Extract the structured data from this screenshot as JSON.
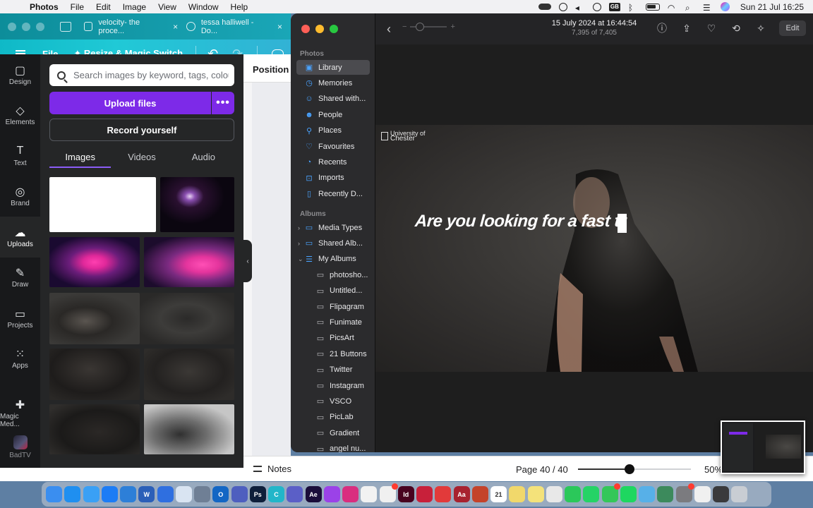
{
  "menubar": {
    "app": "Photos",
    "items": [
      "File",
      "Edit",
      "Image",
      "View",
      "Window",
      "Help"
    ],
    "gb_indicator": "GB",
    "clock": "Sun 21 Jul  16:25"
  },
  "browser": {
    "tabs": [
      {
        "title": "velocity- the proce...",
        "close": "×"
      },
      {
        "title": "tessa halliwell - Do...",
        "close": "×"
      }
    ]
  },
  "canva": {
    "toolbar": {
      "file_label": "File",
      "resize_label": "Resize & Magic Switch"
    },
    "rail": [
      {
        "label": "Design",
        "icon": "design-icon",
        "glyph": "▢"
      },
      {
        "label": "Elements",
        "icon": "elements-icon",
        "glyph": "◇"
      },
      {
        "label": "Text",
        "icon": "text-icon",
        "glyph": "T"
      },
      {
        "label": "Brand",
        "icon": "brand-icon",
        "glyph": "◎"
      },
      {
        "label": "Uploads",
        "icon": "uploads-icon",
        "glyph": "☁"
      },
      {
        "label": "Draw",
        "icon": "draw-icon",
        "glyph": "✎"
      },
      {
        "label": "Projects",
        "icon": "projects-icon",
        "glyph": "▭"
      },
      {
        "label": "Apps",
        "icon": "apps-icon",
        "glyph": "⁙"
      }
    ],
    "magic_label": "Magic Med...",
    "badtv_label": "BadTV",
    "search_placeholder": "Search images by keyword, tags, colour...",
    "upload_label": "Upload files",
    "more_label": "•••",
    "record_label": "Record yourself",
    "media_tabs": [
      "Images",
      "Videos",
      "Audio"
    ],
    "active_media_tab": "Images",
    "position_label": "Position",
    "notes_label": "Notes",
    "page_label": "Page 40 / 40",
    "zoom_percent": 50,
    "zoom_label": "50%",
    "accent": "#7d2ae8"
  },
  "photos": {
    "sidebar": {
      "photos_header": "Photos",
      "library": [
        {
          "label": "Library",
          "icon": "library-icon",
          "glyph": "▣"
        },
        {
          "label": "Memories",
          "icon": "memories-icon",
          "glyph": "◷"
        },
        {
          "label": "Shared with...",
          "icon": "shared-with-icon",
          "glyph": "☺"
        },
        {
          "label": "People",
          "icon": "people-icon",
          "glyph": "☻"
        },
        {
          "label": "Places",
          "icon": "places-icon",
          "glyph": "⚲"
        },
        {
          "label": "Favourites",
          "icon": "favourites-icon",
          "glyph": "♡"
        },
        {
          "label": "Recents",
          "icon": "recents-icon",
          "glyph": "◔"
        },
        {
          "label": "Imports",
          "icon": "imports-icon",
          "glyph": "⊡"
        },
        {
          "label": "Recently D...",
          "icon": "trash-icon",
          "glyph": "▯"
        }
      ],
      "albums_header": "Albums",
      "albums": [
        {
          "label": "Media Types",
          "chev": "›"
        },
        {
          "label": "Shared Alb...",
          "chev": "›"
        },
        {
          "label": "My Albums",
          "chev": "⌄"
        },
        {
          "label": "photosho...",
          "chev": ""
        },
        {
          "label": "Untitled...",
          "chev": ""
        },
        {
          "label": "Flipagram",
          "chev": ""
        },
        {
          "label": "Funimate",
          "chev": ""
        },
        {
          "label": "PicsArt",
          "chev": ""
        },
        {
          "label": "21 Buttons",
          "chev": ""
        },
        {
          "label": "Twitter",
          "chev": ""
        },
        {
          "label": "Instagram",
          "chev": ""
        },
        {
          "label": "VSCO",
          "chev": ""
        },
        {
          "label": "PicLab",
          "chev": ""
        },
        {
          "label": "Gradient",
          "chev": ""
        },
        {
          "label": "angel nu...",
          "chev": ""
        }
      ]
    },
    "toolbar": {
      "date": "15 July 2024 at 16:44:54",
      "count": "7,395 of 7,405",
      "edit_label": "Edit",
      "zoom_minus": "−",
      "zoom_plus": "+"
    },
    "photo": {
      "logo_line1": "University of",
      "logo_line2": "Chester",
      "overlay_text": "Are you looking for a fast tr"
    }
  },
  "dock": {
    "apps": [
      {
        "name": "finder",
        "color": "#3a8ef0",
        "text": ""
      },
      {
        "name": "safari",
        "color": "#1f8ff0",
        "text": ""
      },
      {
        "name": "mail",
        "color": "#3aa0f5",
        "text": ""
      },
      {
        "name": "app-store",
        "color": "#1c7cf5",
        "text": ""
      },
      {
        "name": "calendar-alt",
        "color": "#2d7fd8",
        "text": ""
      },
      {
        "name": "word",
        "color": "#2b5fb8",
        "text": "W"
      },
      {
        "name": "testflight",
        "color": "#2f6fe0",
        "text": ""
      },
      {
        "name": "preview",
        "color": "#d9e4f2",
        "text": ""
      },
      {
        "name": "photo-booth",
        "color": "#6f7f95",
        "text": ""
      },
      {
        "name": "outlook",
        "color": "#1366c4",
        "text": "O"
      },
      {
        "name": "teams",
        "color": "#4e5fbf",
        "text": ""
      },
      {
        "name": "photoshop",
        "color": "#0f1f3a",
        "text": "Ps"
      },
      {
        "name": "canva",
        "color": "#22b6c9",
        "text": "C"
      },
      {
        "name": "teams-2",
        "color": "#5b5fc7",
        "text": ""
      },
      {
        "name": "after-effects",
        "color": "#1a0d3a",
        "text": "Ae"
      },
      {
        "name": "podcasts",
        "color": "#9b42e8",
        "text": ""
      },
      {
        "name": "instagram",
        "color": "#d92e7f",
        "text": ""
      },
      {
        "name": "photos",
        "color": "#f2f2f2",
        "text": ""
      },
      {
        "name": "spark",
        "color": "#f0f0f0",
        "text": "",
        "badge": true
      },
      {
        "name": "indesign",
        "color": "#49021f",
        "text": "Id"
      },
      {
        "name": "ppt-red",
        "color": "#c8203a",
        "text": ""
      },
      {
        "name": "airmail",
        "color": "#e23a3a",
        "text": ""
      },
      {
        "name": "dictionary",
        "color": "#a8222f",
        "text": "Aa"
      },
      {
        "name": "powerpoint",
        "color": "#c4432a",
        "text": ""
      },
      {
        "name": "calendar",
        "color": "#ffffff",
        "text": "21"
      },
      {
        "name": "stickies",
        "color": "#f1d86b",
        "text": ""
      },
      {
        "name": "notes",
        "color": "#f4e27a",
        "text": ""
      },
      {
        "name": "chrome",
        "color": "#e8e8e8",
        "text": ""
      },
      {
        "name": "facetime",
        "color": "#2bc85a",
        "text": ""
      },
      {
        "name": "whatsapp",
        "color": "#25d366",
        "text": ""
      },
      {
        "name": "messages",
        "color": "#34c759",
        "text": "",
        "badge": true
      },
      {
        "name": "spotify",
        "color": "#1ed760",
        "text": ""
      },
      {
        "name": "app-x",
        "color": "#57b0e8",
        "text": ""
      },
      {
        "name": "app-y",
        "color": "#3c8a5c",
        "text": ""
      },
      {
        "name": "system-settings",
        "color": "#7b7b7f",
        "text": "",
        "badge": true
      },
      {
        "name": "capcut",
        "color": "#f0f0f0",
        "text": ""
      },
      {
        "name": "quicktime",
        "color": "#3a3a3c",
        "text": ""
      },
      {
        "name": "trash",
        "color": "#c9cdd3",
        "text": ""
      }
    ]
  }
}
